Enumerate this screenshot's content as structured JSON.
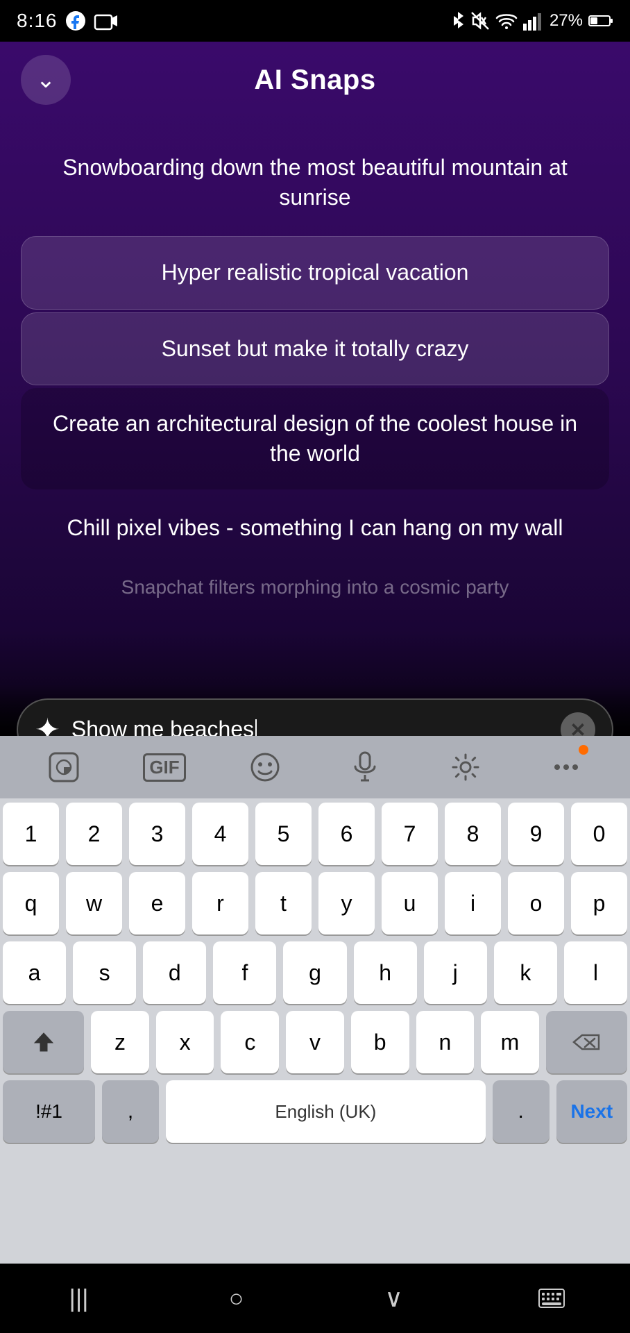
{
  "statusBar": {
    "time": "8:16",
    "battery": "27%",
    "icons": [
      "facebook-icon",
      "camera-icon",
      "bluetooth-icon",
      "mute-icon",
      "wifi-icon",
      "signal-icon",
      "battery-icon"
    ]
  },
  "header": {
    "title": "AI Snaps",
    "backLabel": "chevron-down"
  },
  "prompts": [
    {
      "id": "prompt-1",
      "text": "Snowboarding down the most beautiful mountain at sunrise",
      "style": "normal"
    },
    {
      "id": "prompt-2",
      "text": "Hyper realistic tropical vacation",
      "style": "highlighted"
    },
    {
      "id": "prompt-3",
      "text": "Sunset but make it totally crazy",
      "style": "highlighted"
    },
    {
      "id": "prompt-4",
      "text": "Create an architectural design of the coolest house in the world",
      "style": "darker"
    },
    {
      "id": "prompt-5",
      "text": "Chill pixel vibes - something I can hang on my wall",
      "style": "normal"
    },
    {
      "id": "prompt-6",
      "text": "Snapchat filters morphing into a cosmic party",
      "style": "partial"
    }
  ],
  "inputBox": {
    "value": "Show me beaches",
    "placeholder": "Show me beaches",
    "sparkleIcon": "✦",
    "clearIcon": "×"
  },
  "keyboard": {
    "toolbarItems": [
      {
        "icon": "sticker",
        "label": "sticker-icon"
      },
      {
        "icon": "GIF",
        "label": "gif-icon"
      },
      {
        "icon": "emoji",
        "label": "emoji-icon"
      },
      {
        "icon": "microphone",
        "label": "mic-icon"
      },
      {
        "icon": "settings",
        "label": "settings-icon"
      },
      {
        "icon": "more",
        "label": "more-icon"
      }
    ],
    "rows": [
      [
        "1",
        "2",
        "3",
        "4",
        "5",
        "6",
        "7",
        "8",
        "9",
        "0"
      ],
      [
        "q",
        "w",
        "e",
        "r",
        "t",
        "y",
        "u",
        "i",
        "o",
        "p"
      ],
      [
        "a",
        "s",
        "d",
        "f",
        "g",
        "h",
        "j",
        "k",
        "l"
      ],
      [
        "↑",
        "z",
        "x",
        "c",
        "v",
        "b",
        "n",
        "m",
        "⌫"
      ],
      [
        "!#1",
        ",",
        "English (UK)",
        ".",
        "Next"
      ]
    ]
  },
  "bottomNav": {
    "items": [
      "|||",
      "○",
      "∨",
      "⊞"
    ]
  }
}
